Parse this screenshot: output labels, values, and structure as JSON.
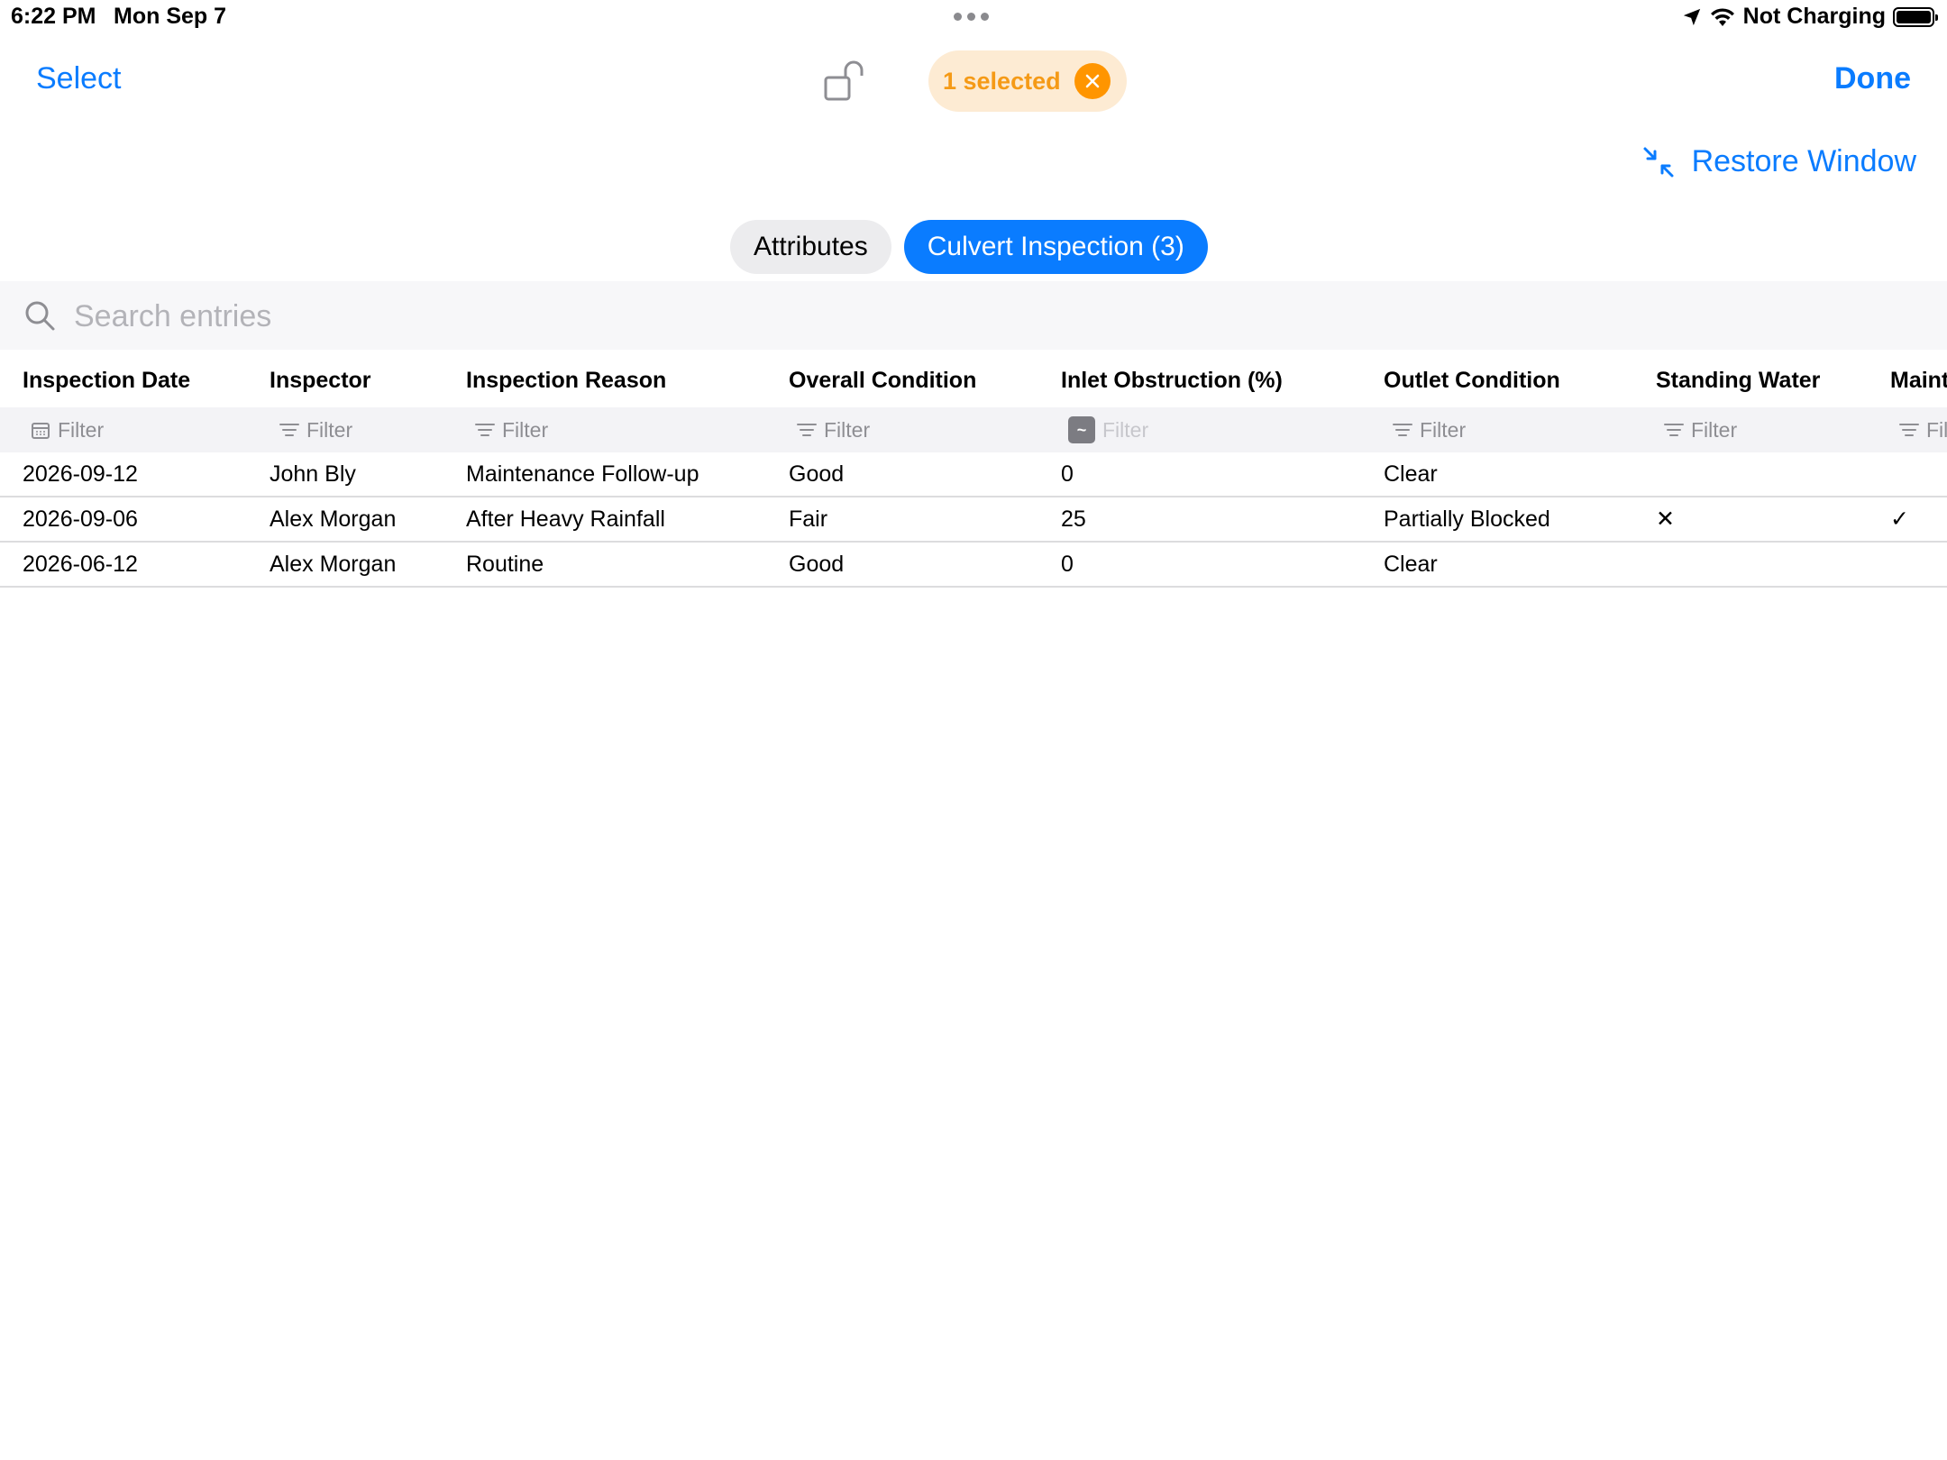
{
  "status_bar": {
    "time": "6:22 PM",
    "date": "Mon Sep 7",
    "charging": "Not Charging"
  },
  "nav": {
    "select_label": "Select",
    "selection_count": "1 selected",
    "done_label": "Done",
    "restore_label": "Restore Window"
  },
  "tabs": [
    {
      "label": "Attributes",
      "active": false
    },
    {
      "label": "Culvert Inspection (3)",
      "active": true
    }
  ],
  "search": {
    "placeholder": "Search entries",
    "value": ""
  },
  "table": {
    "columns": [
      "Inspection Date",
      "Inspector",
      "Inspection Reason",
      "Overall Condition",
      "Inlet Obstruction (%)",
      "Outlet Condition",
      "Standing Water",
      "Maint"
    ],
    "filter_label": "Filter",
    "filter_label_cut": "Fil",
    "approx_symbol": "~",
    "rows": [
      [
        "2026-09-12",
        "John Bly",
        "Maintenance Follow-up",
        "Good",
        "0",
        "Clear",
        "",
        ""
      ],
      [
        "2026-09-06",
        "Alex Morgan",
        "After Heavy Rainfall",
        "Fair",
        "25",
        "Partially Blocked",
        "✕",
        "✓"
      ],
      [
        "2026-06-12",
        "Alex Morgan",
        "Routine",
        "Good",
        "0",
        "Clear",
        "",
        ""
      ]
    ]
  },
  "colors": {
    "accent": "#0a7cff",
    "pill_bg": "#fdebd3",
    "pill_text": "#f59a16",
    "pill_clear": "#ff9500"
  }
}
